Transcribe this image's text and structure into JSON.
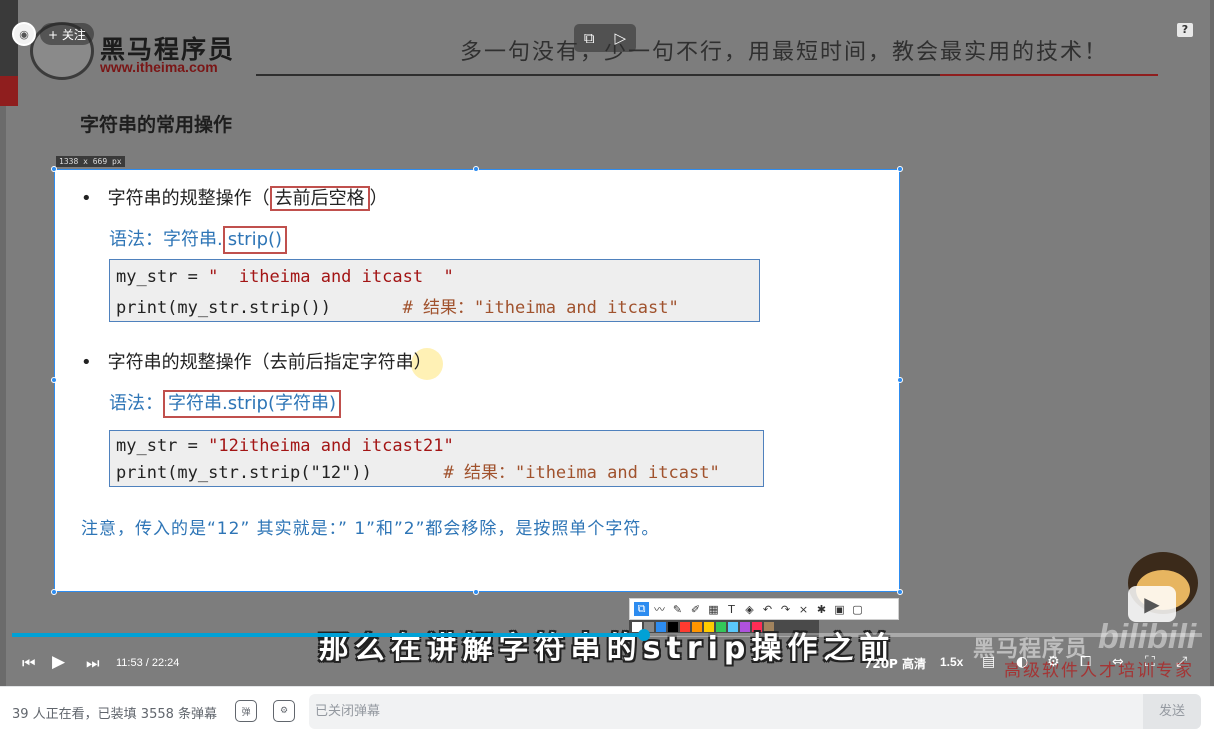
{
  "uploader": {
    "follow_label": "+ 关注"
  },
  "slide_header": {
    "logo_text": "黑马程序员",
    "logo_url": "www.itheima.com",
    "slogan": "多一句没有，少一句不行，用最短时间，教会最实用的技术！",
    "section_title": "字符串的常用操作"
  },
  "capture_size_label": "1338 x 669  px",
  "slide": {
    "bullet1": {
      "prefix": "字符串的规整操作（",
      "highlight": "去前后空格",
      "suffix": "）"
    },
    "syntax1": {
      "prefix": "语法：字符串.",
      "highlight": "strip()"
    },
    "code1": [
      {
        "a": "my_str = ",
        "s": "\"  itheima and itcast  \"",
        "c": ""
      },
      {
        "a": "print(my_str.strip())       ",
        "s": "",
        "c": "# 结果：\"itheima and itcast\""
      }
    ],
    "bullet2": {
      "text": "字符串的规整操作（去前后指定字符串）"
    },
    "syntax2": {
      "prefix": "语法：",
      "highlight": "字符串.strip(字符串)"
    },
    "code2": [
      {
        "a": "my_str = ",
        "s": "\"12itheima and itcast21\"",
        "c": ""
      },
      {
        "a": "print(my_str.strip(\"12\"))       ",
        "s": "",
        "c": "# 结果：\"itheima and itcast\""
      }
    ],
    "note": "注意，传入的是“12” 其实就是：” 1”和”2”都会移除，是按照单个字符。"
  },
  "subtitle": "那么在讲解字符串的strip操作之前",
  "watermark": {
    "brand": "黑马程序员",
    "site": "bilibili",
    "tagline": "高级软件人才培训专家"
  },
  "player": {
    "time_current": "11:53",
    "time_total": "22:24",
    "progress": 0.531,
    "quality": "720P 高清",
    "speed": "1.5x",
    "help": "?"
  },
  "colors": {
    "accent": "#00a1d6",
    "selection": "#2d8cf0",
    "code_string": "#a31515",
    "syntax_blue": "#2e75b6"
  },
  "danmaku": {
    "viewers": "39 人正在看，已装填 3558 条弹幕",
    "placeholder": "已关闭弹幕",
    "send_label": "发送"
  }
}
